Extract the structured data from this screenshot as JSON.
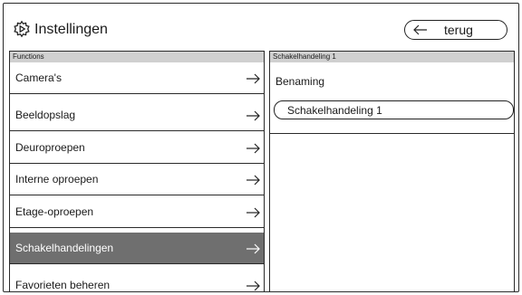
{
  "window": {
    "title": "Instellingen",
    "title_icon": "settings-gear-icon",
    "back_label": "terug",
    "back_icon": "arrow-left-icon"
  },
  "left_panel": {
    "header": "Functions",
    "items": [
      {
        "label": "Camera's",
        "selected": false
      },
      {
        "label": "Beeldopslag",
        "selected": false
      },
      {
        "label": "Deuroproepen",
        "selected": false
      },
      {
        "label": "Interne oproepen",
        "selected": false
      },
      {
        "label": "Etage-oproepen",
        "selected": false
      },
      {
        "label": "Schakelhandelingen",
        "selected": true
      },
      {
        "label": "Favorieten beheren",
        "selected": false
      }
    ],
    "item_icon": "arrow-right-icon"
  },
  "right_panel": {
    "header": "Schakelhandeling 1",
    "field_label": "Benaming",
    "field_value": "Schakelhandeling 1"
  },
  "colors": {
    "border": "#2a2a2a",
    "header_bg": "#d0d0d0",
    "selected_bg": "#6f6f6f",
    "selected_text": "#ffffff"
  }
}
